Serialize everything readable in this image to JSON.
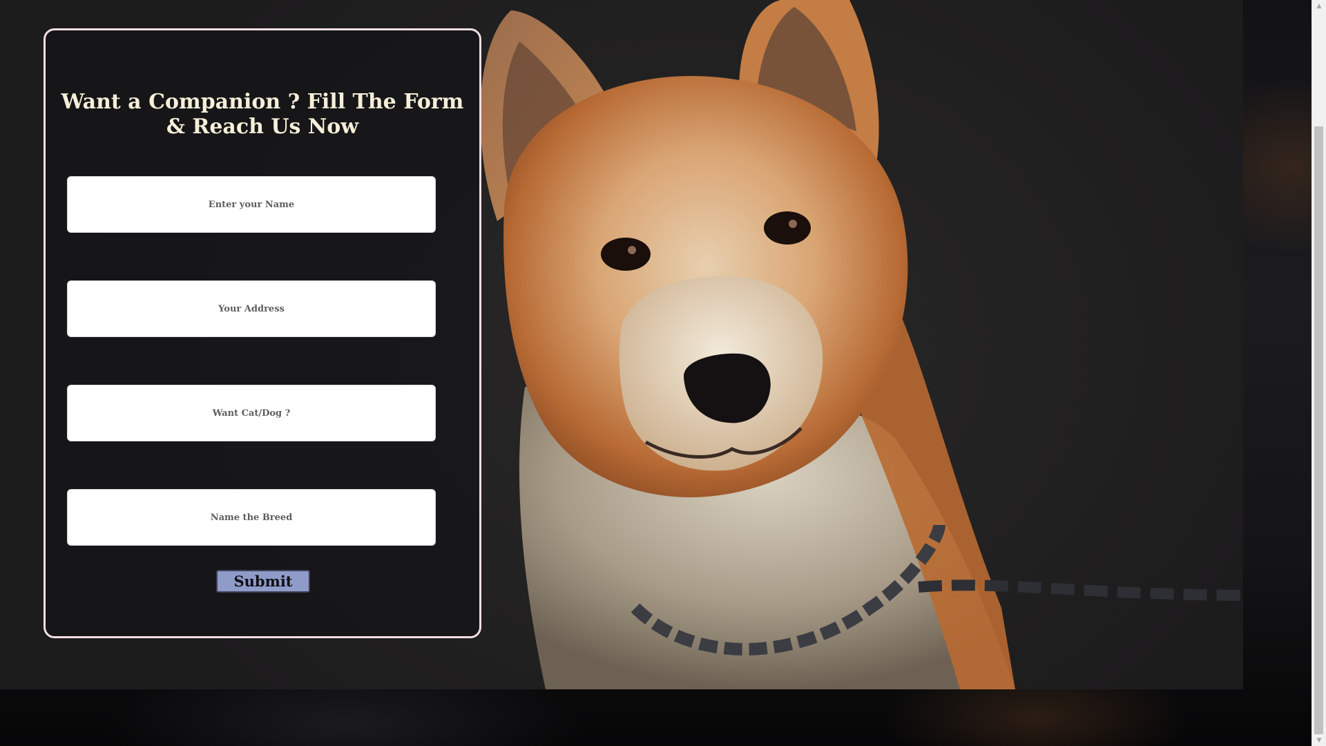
{
  "form": {
    "title": "Want a Companion ? Fill The Form & Reach Us Now",
    "fields": {
      "name": {
        "placeholder": "Enter your Name",
        "value": ""
      },
      "address": {
        "placeholder": "Your Address",
        "value": ""
      },
      "pet_type": {
        "placeholder": "Want Cat/Dog ?",
        "value": ""
      },
      "breed": {
        "placeholder": "Name the Breed",
        "value": ""
      }
    },
    "submit_label": "Submit"
  },
  "scrollbar": {
    "up_arrow": "▲",
    "down_arrow": "▼"
  },
  "colors": {
    "card_border": "#f4dfe4",
    "title_text": "#f6efd9",
    "submit_bg": "#8f9bc9"
  },
  "icons": {
    "scroll_up": "scroll-up-arrow-icon",
    "scroll_down": "scroll-down-arrow-icon"
  }
}
